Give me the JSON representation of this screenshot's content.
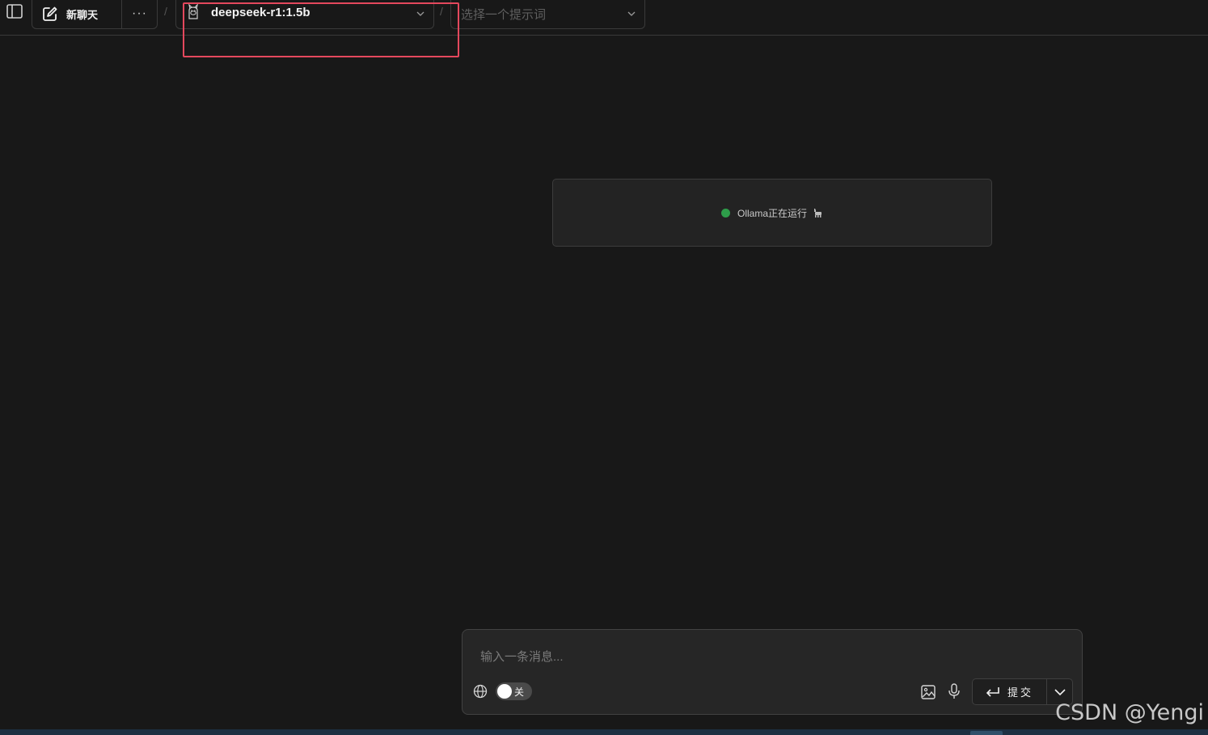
{
  "header": {
    "new_chat_label": "新聊天",
    "more_label": "···",
    "separator": "/",
    "model_name": "deepseek-r1:1.5b",
    "prompt_placeholder": "选择一个提示词"
  },
  "status": {
    "text": "Ollama正在运行",
    "dot_color": "#2e9d4a"
  },
  "composer": {
    "placeholder": "输入一条消息...",
    "web_toggle_label": "关",
    "submit_label": "提交",
    "icons": [
      "globe-icon",
      "image-icon",
      "mic-icon",
      "enter-icon",
      "chevron-down-icon"
    ]
  },
  "highlight": {
    "color": "#e4485d"
  },
  "watermark": {
    "text": "CSDN @Yengi"
  }
}
